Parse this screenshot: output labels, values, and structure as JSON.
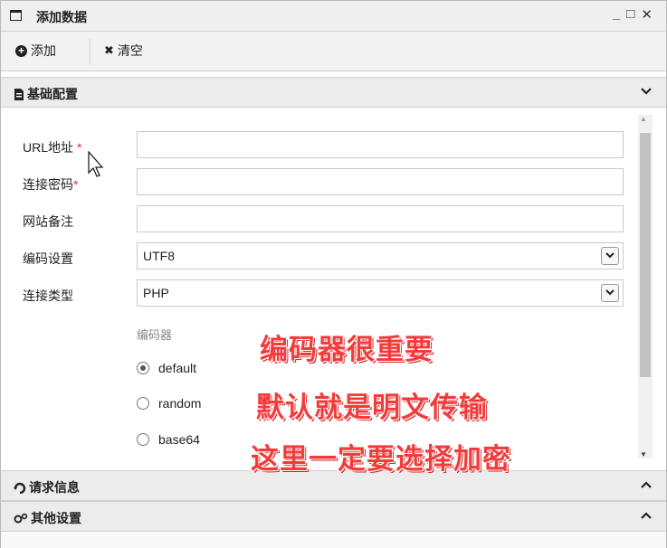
{
  "window": {
    "title": "添加数据",
    "controls": [
      "_",
      "□",
      "✕"
    ]
  },
  "toolbar": {
    "add_label": "添加",
    "clear_label": "清空"
  },
  "sections": {
    "basic": {
      "label": "基础配置",
      "chevron": "⌄"
    },
    "request": {
      "label": "请求信息",
      "chevron": "⌃"
    },
    "other": {
      "label": "其他设置",
      "chevron": "⌃"
    }
  },
  "form": {
    "url_label": "URL地址",
    "password_label": "连接密码",
    "note_label": "网站备注",
    "encoding_label": "编码设置",
    "encoding_value": "UTF8",
    "type_label": "连接类型",
    "type_value": "PHP",
    "required_mark": "*",
    "url_value": "",
    "password_value": "",
    "note_value": ""
  },
  "encoder": {
    "title": "编码器",
    "options": [
      {
        "label": "default",
        "checked": true
      },
      {
        "label": "random",
        "checked": false
      },
      {
        "label": "base64",
        "checked": false
      }
    ]
  },
  "annotations": {
    "line1": "编码器很重要",
    "line2": "默认就是明文传输",
    "line3": "这里一定要选择加密"
  },
  "icons": {
    "window": "window-icon",
    "add": "circle-plus-icon",
    "clear": "close-icon",
    "basic": "document-icon",
    "request": "refresh-icon",
    "other": "gears-icon"
  },
  "colors": {
    "annotation": "#f23b3b",
    "required": "#e03030"
  }
}
